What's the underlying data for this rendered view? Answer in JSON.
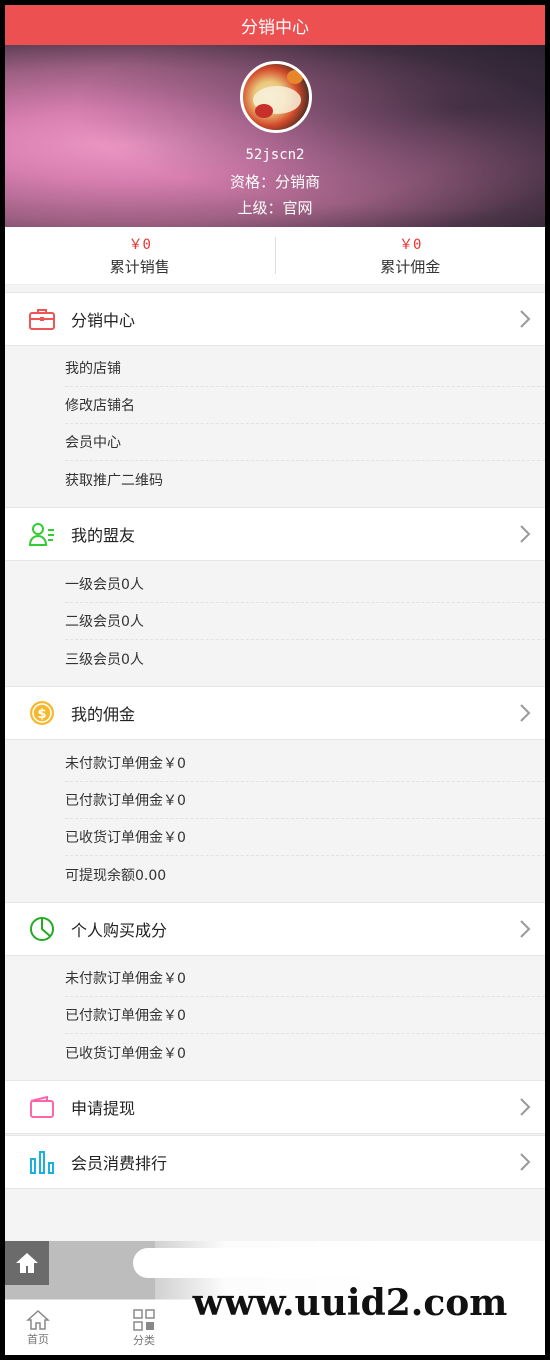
{
  "header": {
    "title": "分销中心"
  },
  "profile": {
    "username": "52jscn2",
    "qualification": "资格：分销商",
    "superior": "上级：官网"
  },
  "stats": [
    {
      "value": "￥0",
      "label": "累计销售"
    },
    {
      "value": "￥0",
      "label": "累计佣金"
    }
  ],
  "sections": [
    {
      "title": "分销中心",
      "icon": "briefcase-icon",
      "color": "#e55",
      "items": [
        "我的店铺",
        "修改店铺名",
        "会员中心",
        "获取推广二维码"
      ]
    },
    {
      "title": "我的盟友",
      "icon": "friends-icon",
      "color": "#3c3",
      "items": [
        "一级会员0人",
        "二级会员0人",
        "三级会员0人"
      ]
    },
    {
      "title": "我的佣金",
      "icon": "coin-icon",
      "color": "#f0a020",
      "items": [
        "未付款订单佣金￥0",
        "已付款订单佣金￥0",
        "已收货订单佣金￥0",
        "可提现余额0.00"
      ]
    },
    {
      "title": "个人购买成分",
      "icon": "pie-chart-icon",
      "color": "#2a2",
      "items": [
        "未付款订单佣金￥0",
        "已付款订单佣金￥0",
        "已收货订单佣金￥0"
      ]
    },
    {
      "title": "申请提现",
      "icon": "wallet-icon",
      "color": "#f6a",
      "items": []
    },
    {
      "title": "会员消费排行",
      "icon": "bar-chart-icon",
      "color": "#1ab0e0",
      "items": []
    }
  ],
  "tabbar": [
    {
      "label": "首页",
      "icon": "home-icon"
    },
    {
      "label": "分类",
      "icon": "grid-icon"
    }
  ],
  "watermark": "www.uuid2.com"
}
